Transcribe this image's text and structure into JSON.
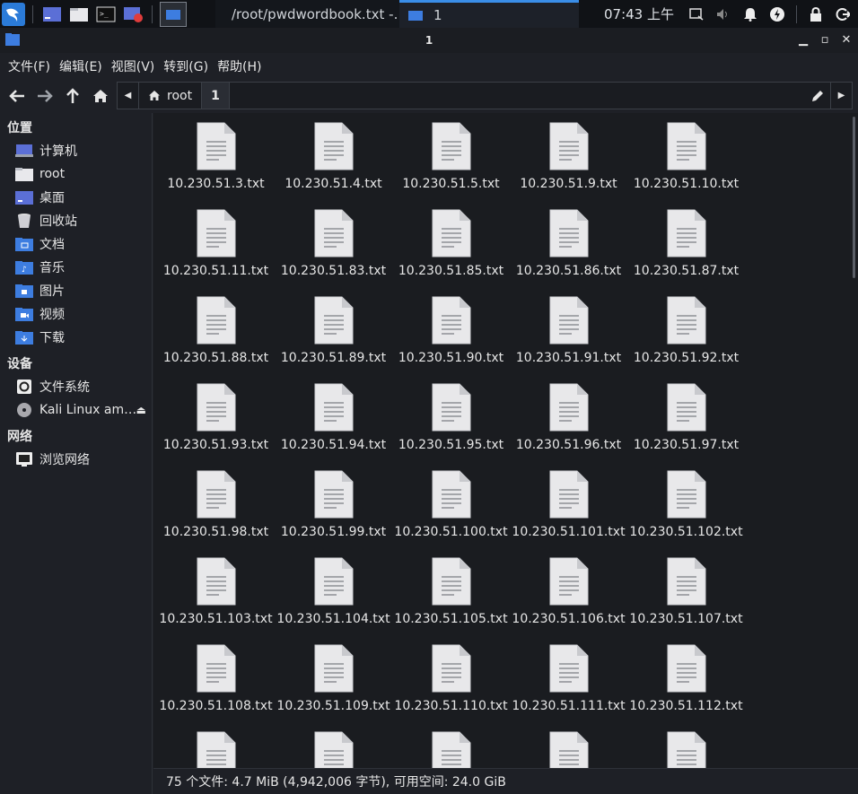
{
  "taskbar": {
    "tasks": [
      {
        "label": "/root/pwdwordbook.txt -…"
      },
      {
        "label": "1"
      }
    ],
    "clock": "07:43 上午"
  },
  "window": {
    "title": "1"
  },
  "menu": {
    "file": "文件(F)",
    "edit": "编辑(E)",
    "view": "视图(V)",
    "go": "转到(G)",
    "help": "帮助(H)"
  },
  "path": {
    "segments": [
      "root",
      "1"
    ]
  },
  "sidebar": {
    "places_heading": "位置",
    "places": [
      {
        "label": "计算机",
        "icon": "computer-icon"
      },
      {
        "label": "root",
        "icon": "home-folder-icon"
      },
      {
        "label": "桌面",
        "icon": "desktop-folder-icon"
      },
      {
        "label": "回收站",
        "icon": "trash-icon"
      },
      {
        "label": "文档",
        "icon": "documents-folder-icon"
      },
      {
        "label": "音乐",
        "icon": "music-folder-icon"
      },
      {
        "label": "图片",
        "icon": "pictures-folder-icon"
      },
      {
        "label": "视频",
        "icon": "videos-folder-icon"
      },
      {
        "label": "下载",
        "icon": "downloads-folder-icon"
      }
    ],
    "devices_heading": "设备",
    "devices": [
      {
        "label": "文件系统",
        "icon": "drive-icon"
      },
      {
        "label": "Kali Linux am…",
        "icon": "optical-disc-icon"
      }
    ],
    "network_heading": "网络",
    "network": [
      {
        "label": "浏览网络",
        "icon": "network-icon"
      }
    ]
  },
  "files": [
    "10.230.51.3.txt",
    "10.230.51.4.txt",
    "10.230.51.5.txt",
    "10.230.51.9.txt",
    "10.230.51.10.txt",
    "10.230.51.11.txt",
    "10.230.51.83.txt",
    "10.230.51.85.txt",
    "10.230.51.86.txt",
    "10.230.51.87.txt",
    "10.230.51.88.txt",
    "10.230.51.89.txt",
    "10.230.51.90.txt",
    "10.230.51.91.txt",
    "10.230.51.92.txt",
    "10.230.51.93.txt",
    "10.230.51.94.txt",
    "10.230.51.95.txt",
    "10.230.51.96.txt",
    "10.230.51.97.txt",
    "10.230.51.98.txt",
    "10.230.51.99.txt",
    "10.230.51.100.txt",
    "10.230.51.101.txt",
    "10.230.51.102.txt",
    "10.230.51.103.txt",
    "10.230.51.104.txt",
    "10.230.51.105.txt",
    "10.230.51.106.txt",
    "10.230.51.107.txt",
    "10.230.51.108.txt",
    "10.230.51.109.txt",
    "10.230.51.110.txt",
    "10.230.51.111.txt",
    "10.230.51.112.txt",
    "",
    "",
    "",
    "",
    ""
  ],
  "status": "75 个文件: 4.7 MiB (4,942,006 字节), 可用空间: 24.0 GiB",
  "colors": {
    "accent": "#3a8ee8",
    "folder": "#3d7de0",
    "background": "#1a1c20"
  }
}
